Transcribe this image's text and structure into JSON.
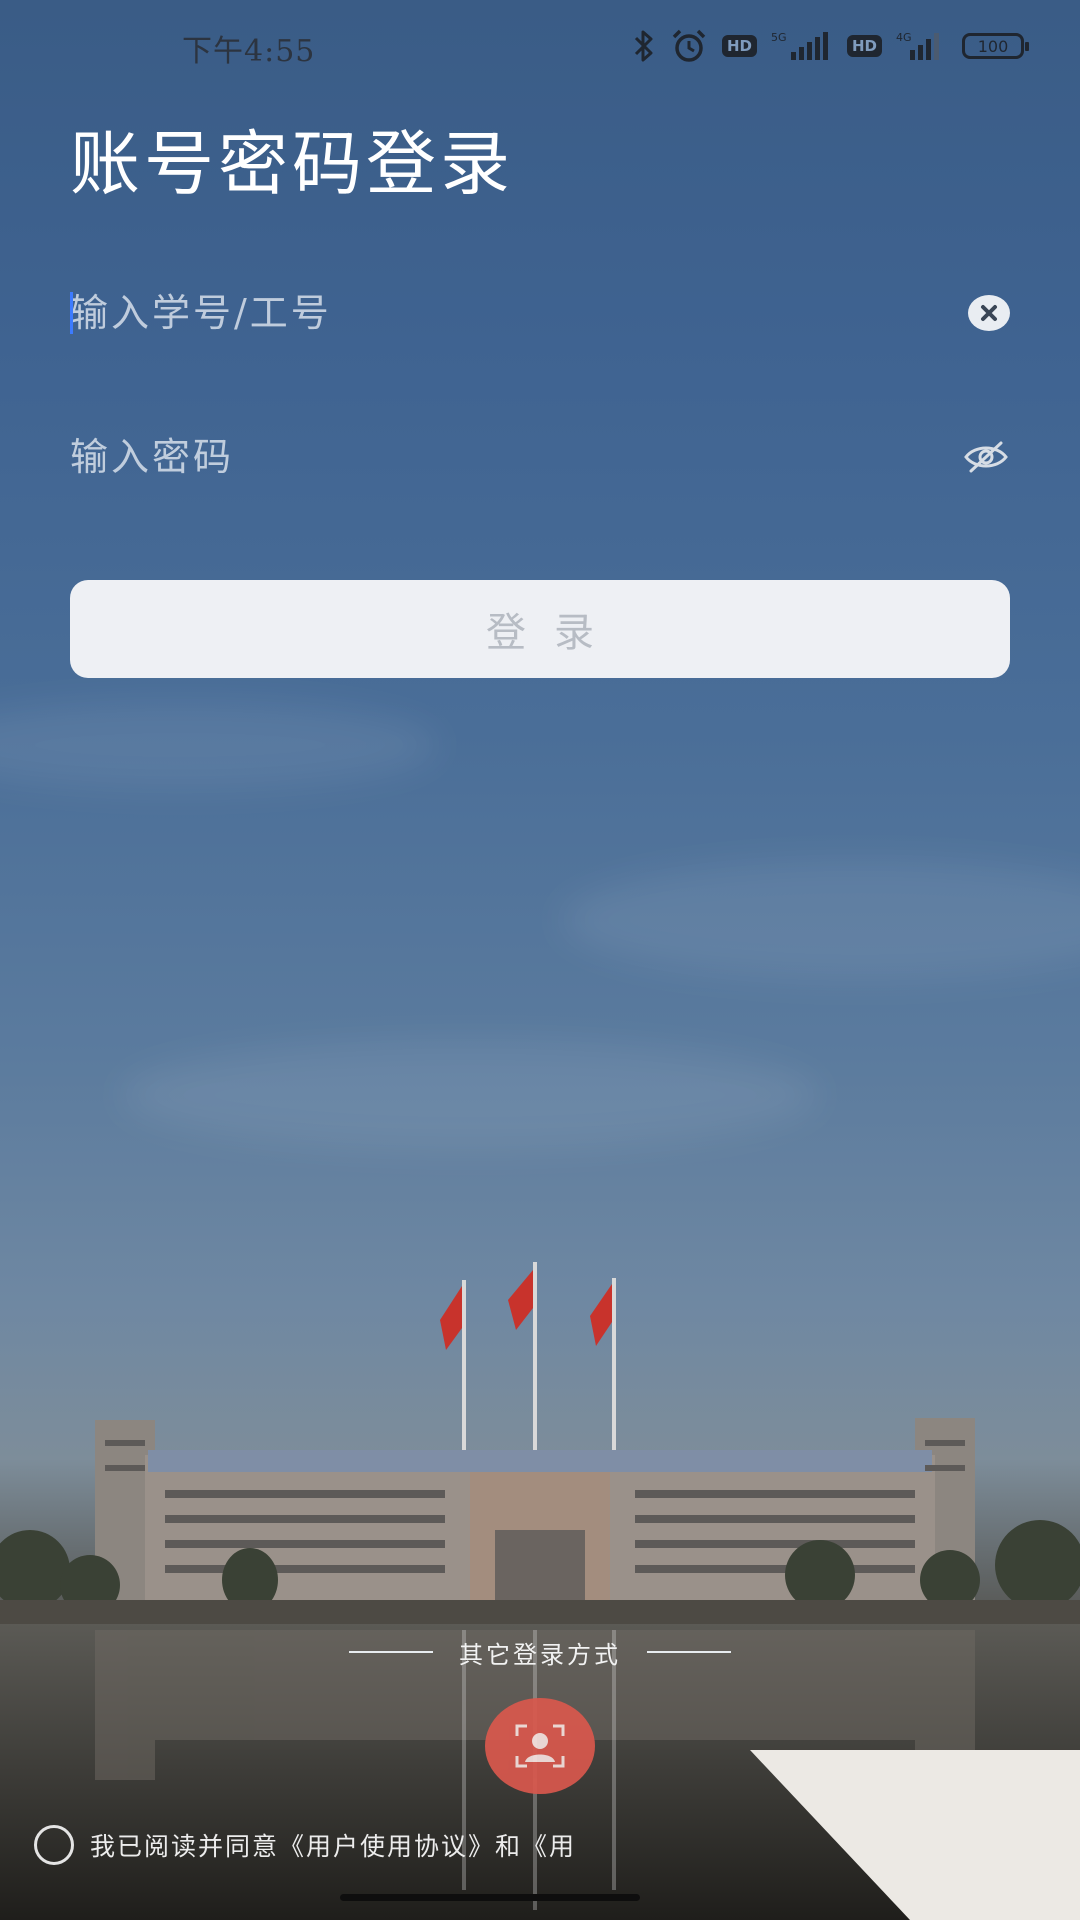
{
  "status_bar": {
    "time": "下午4:55",
    "hd1": "HD",
    "net1": "5G",
    "hd2": "HD",
    "net2": "4G",
    "battery": "100",
    "icons": [
      "bluetooth-icon",
      "alarm-icon",
      "signal-icon",
      "battery-icon"
    ]
  },
  "title": "账号密码登录",
  "form": {
    "account_placeholder": "输入学号/工号",
    "password_placeholder": "输入密码",
    "login_label": "登录"
  },
  "other_login": {
    "label": "其它登录方式"
  },
  "agreement": {
    "text": "我已阅读并同意《用户使用协议》和《用"
  },
  "colors": {
    "accent_face": "#d9584d",
    "button_bg": "#eef0f4",
    "button_text": "#b7bcc4"
  }
}
